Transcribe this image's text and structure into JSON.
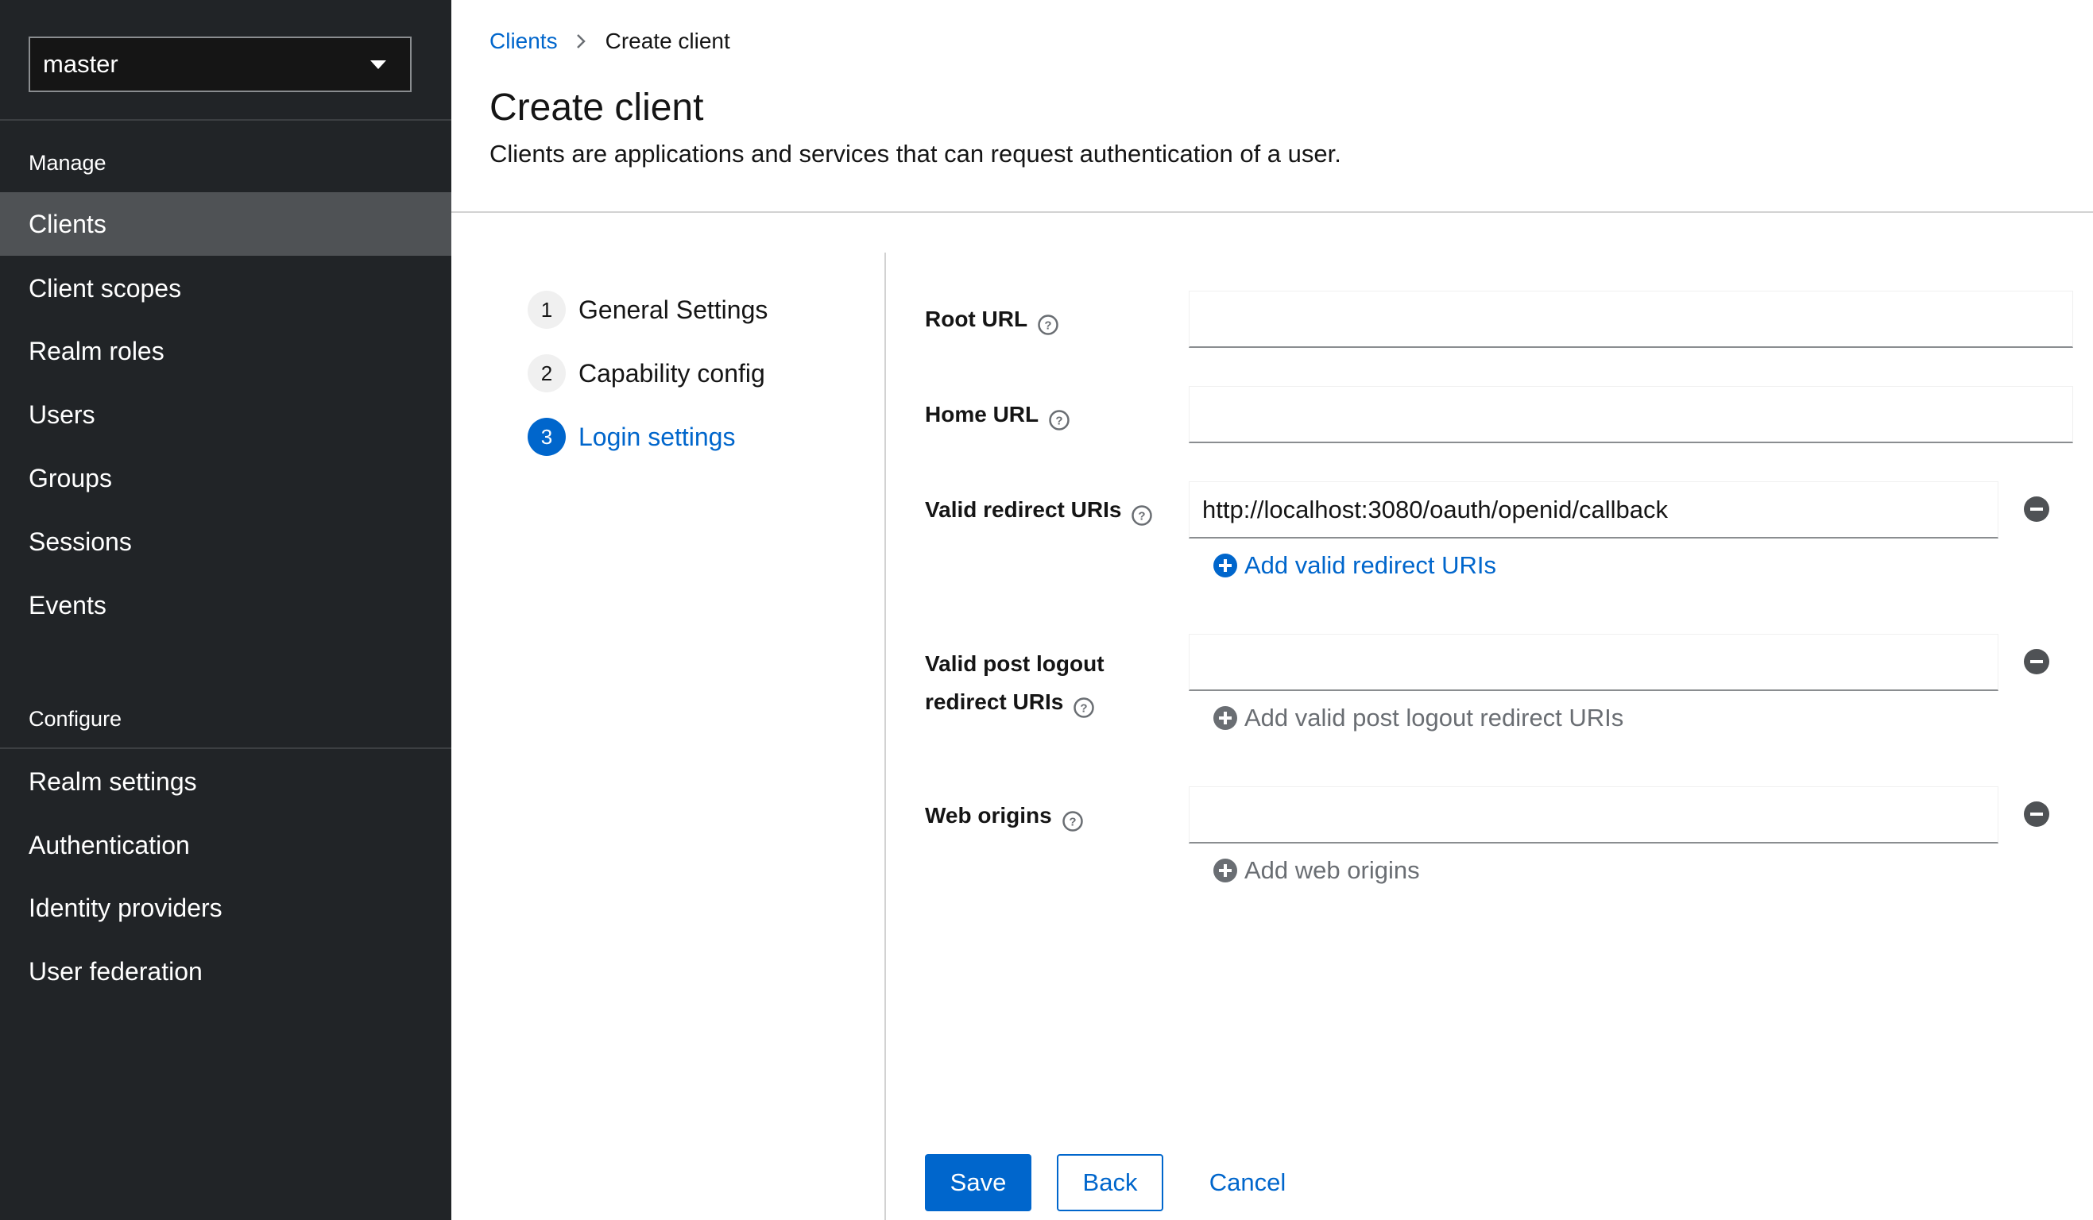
{
  "sidebar": {
    "realm": "master",
    "sections": [
      {
        "title": "Manage",
        "items": [
          "Clients",
          "Client scopes",
          "Realm roles",
          "Users",
          "Groups",
          "Sessions",
          "Events"
        ]
      },
      {
        "title": "Configure",
        "items": [
          "Realm settings",
          "Authentication",
          "Identity providers",
          "User federation"
        ]
      }
    ],
    "active_item": "Clients"
  },
  "breadcrumb": {
    "parent": "Clients",
    "current": "Create client"
  },
  "page": {
    "title": "Create client",
    "description": "Clients are applications and services that can request authentication of a user."
  },
  "wizard": {
    "steps": [
      {
        "number": "1",
        "label": "General Settings"
      },
      {
        "number": "2",
        "label": "Capability config"
      },
      {
        "number": "3",
        "label": "Login settings"
      }
    ],
    "current_step": "3"
  },
  "form": {
    "root_url": {
      "label": "Root URL",
      "value": ""
    },
    "home_url": {
      "label": "Home URL",
      "value": ""
    },
    "valid_redirect_uris": {
      "label": "Valid redirect URIs",
      "value": "http://localhost:3080/oauth/openid/callback",
      "add_label": "Add valid redirect URIs"
    },
    "valid_post_logout": {
      "label_line1": "Valid post logout",
      "label_line2": "redirect URIs",
      "value": "",
      "add_label": "Add valid post logout redirect URIs"
    },
    "web_origins": {
      "label": "Web origins",
      "value": "",
      "add_label": "Add web origins"
    }
  },
  "footer": {
    "save": "Save",
    "back": "Back",
    "cancel": "Cancel"
  },
  "colors": {
    "accent": "#0066cc",
    "sidebar_bg": "#212427",
    "active_nav": "#4f5255"
  },
  "icons": [
    "caret-down-icon",
    "chevron-right-icon",
    "help-icon",
    "minus-circle-icon",
    "plus-circle-icon"
  ]
}
